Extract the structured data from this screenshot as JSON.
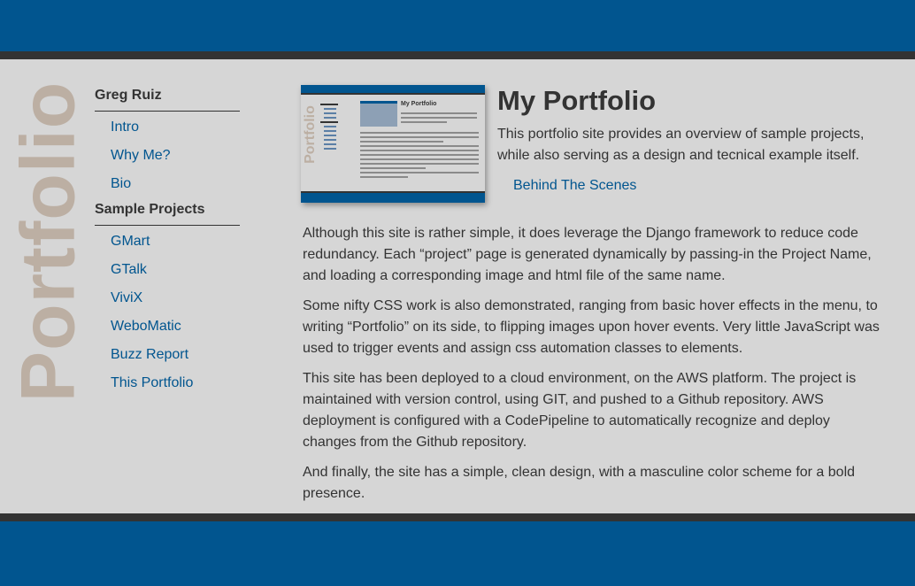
{
  "sidebar": {
    "vertical_title": "Portfolio",
    "sections": [
      {
        "heading": "Greg Ruiz",
        "items": [
          "Intro",
          "Why Me?",
          "Bio"
        ]
      },
      {
        "heading": "Sample Projects",
        "items": [
          "GMart",
          "GTalk",
          "ViviX",
          "WeboMatic",
          "Buzz Report",
          "This Portfolio"
        ]
      }
    ]
  },
  "main": {
    "title": "My Portfolio",
    "intro": "This portfolio site provides an overview of sample projects, while also serving as a design and tecnical example itself.",
    "behind_link": "Behind The Scenes",
    "thumbnail": {
      "side_text": "Portfolio",
      "title": "My Portfolio"
    },
    "paragraphs": [
      "Although this site is rather simple, it does leverage the Django framework to reduce code redundancy. Each “project” page is generated dynamically by passing-in the Project Name, and loading a corresponding image and html file of the same name.",
      "Some nifty CSS work is also demonstrated, ranging from basic hover effects in the menu, to writing “Portfolio” on its side, to flipping images upon hover events. Very little JavaScript was used to trigger events and assign css automation classes to elements.",
      "This site has been deployed to a cloud environment, on the AWS platform. The project is maintained with version control, using GIT, and pushed to a Github repository. AWS deployment is configured with a CodePipeline to automatically recognize and deploy changes from the Github repository.",
      "And finally, the site has a simple, clean design, with a masculine color scheme for a bold presence."
    ]
  },
  "colors": {
    "brand_blue": "#01558f",
    "dark_rule": "#333333",
    "background": "#d6d6d6",
    "vertical_title": "#bcafa3"
  }
}
